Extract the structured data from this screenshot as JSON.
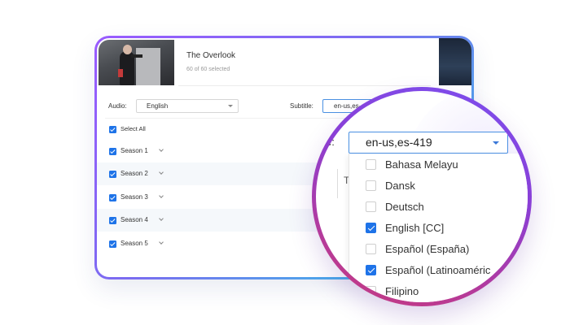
{
  "movie": {
    "title": "The Overlook",
    "selection": "60 of 60 selected"
  },
  "controls": {
    "audio_label": "Audio:",
    "audio_value": "English",
    "subtitle_label": "Subtitle:",
    "subtitle_value": "en-us,es-"
  },
  "list": {
    "select_all": "Select All",
    "seasons": [
      {
        "label": "Season 1",
        "checked": true
      },
      {
        "label": "Season 2",
        "checked": true
      },
      {
        "label": "Season 3",
        "checked": true
      },
      {
        "label": "Season 4",
        "checked": true
      },
      {
        "label": "Season 5",
        "checked": true
      }
    ]
  },
  "magnifier": {
    "label_fragment": "e:",
    "subtitle_value": "en-us,es-419",
    "fragment_t": "T",
    "options": [
      {
        "label": "Bahasa Melayu",
        "checked": false
      },
      {
        "label": "Dansk",
        "checked": false
      },
      {
        "label": "Deutsch",
        "checked": false
      },
      {
        "label": "English [CC]",
        "checked": true
      },
      {
        "label": "Español (España)",
        "checked": false
      },
      {
        "label": "Español (Latinoaméric",
        "checked": true
      },
      {
        "label": "Filipino",
        "checked": false
      }
    ]
  },
  "colors": {
    "accent": "#1e73e8",
    "ring_start": "#7b4ff0",
    "ring_end": "#c83a7c",
    "border_start": "#9a5bff",
    "border_end": "#2bd3e6"
  }
}
